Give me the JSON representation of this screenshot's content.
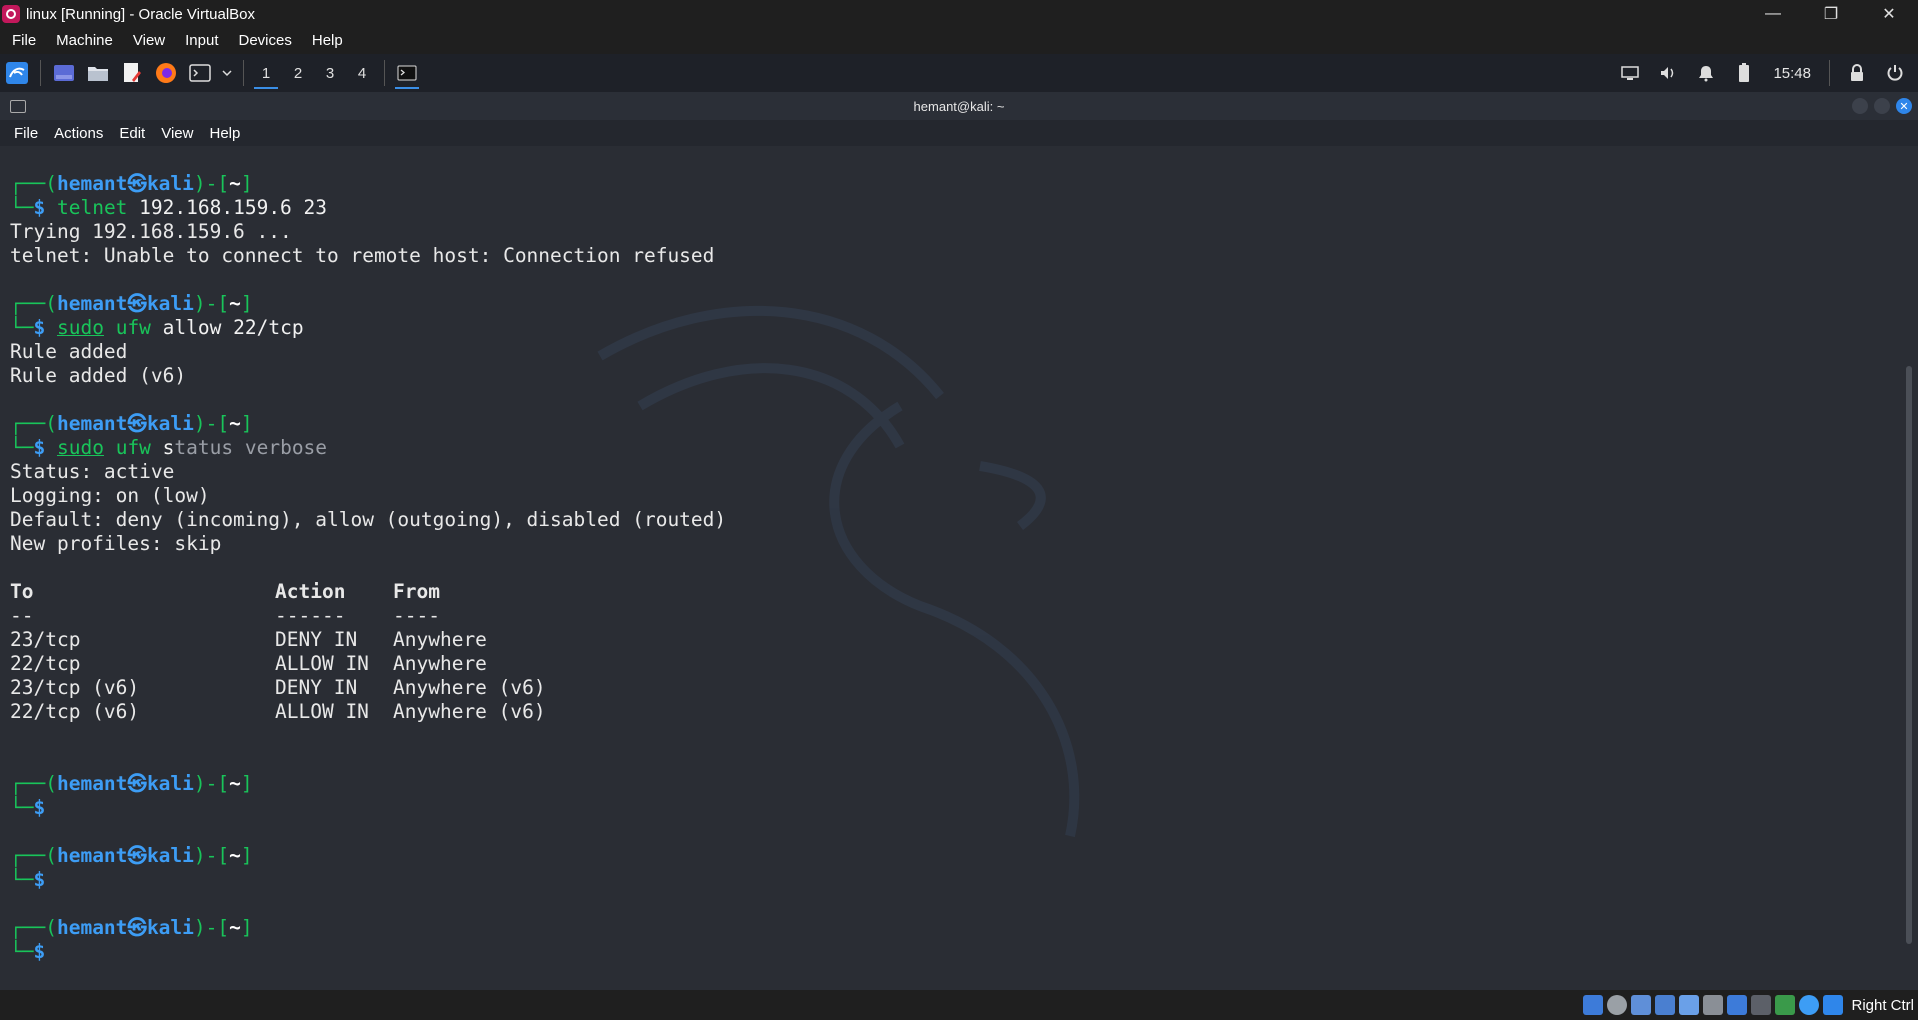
{
  "window": {
    "title": "linux [Running] - Oracle VirtualBox",
    "minimize": "—",
    "restore": "❐",
    "close": "✕"
  },
  "vb_menu": [
    "File",
    "Machine",
    "View",
    "Input",
    "Devices",
    "Help"
  ],
  "panel": {
    "workspaces": [
      "1",
      "2",
      "3",
      "4"
    ],
    "active_workspace": "1",
    "clock": "15:48",
    "icons": [
      "kali-menu-icon",
      "desktop-icon",
      "file-manager-icon",
      "text-editor-icon",
      "firefox-icon",
      "terminal-icon",
      "chevron-down-icon"
    ],
    "tray_icons": [
      "display-icon",
      "volume-icon",
      "notification-icon",
      "battery-icon",
      "lock-icon",
      "power-icon"
    ]
  },
  "terminal": {
    "title": "hemant@kali: ~",
    "menu": [
      "File",
      "Actions",
      "Edit",
      "View",
      "Help"
    ],
    "prompt": {
      "user": "hemant",
      "host": "kali",
      "symbol": "㉿",
      "dir": "~",
      "dollar": "$"
    },
    "commands": {
      "c1": {
        "cmd": "telnet",
        "args": " 192.168.159.6 23"
      },
      "c2": {
        "sudo": "sudo",
        "cmd": "ufw",
        "args": " allow 22/tcp"
      },
      "c3": {
        "sudo": "sudo",
        "cmd": "ufw",
        "typed": " s",
        "ghost": "tatus verbose"
      }
    },
    "output": {
      "telnet_1": "Trying 192.168.159.6 ...",
      "telnet_2": "telnet: Unable to connect to remote host: Connection refused",
      "rule_1": "Rule added",
      "rule_2": "Rule added (v6)",
      "status": "Status: active",
      "logging": "Logging: on (low)",
      "default": "Default: deny (incoming), allow (outgoing), disabled (routed)",
      "profiles": "New profiles: skip"
    },
    "table": {
      "headers": {
        "to": "To",
        "action": "Action",
        "from": "From"
      },
      "dashes": {
        "to": "--",
        "action": "------",
        "from": "----"
      },
      "rows": [
        {
          "to": "23/tcp",
          "action": "DENY IN",
          "from": "Anywhere"
        },
        {
          "to": "22/tcp",
          "action": "ALLOW IN",
          "from": "Anywhere"
        },
        {
          "to": "23/tcp (v6)",
          "action": "DENY IN",
          "from": "Anywhere (v6)"
        },
        {
          "to": "22/tcp (v6)",
          "action": "ALLOW IN",
          "from": "Anywhere (v6)"
        }
      ]
    }
  },
  "status_bar": {
    "host_key": "Right Ctrl",
    "icons": [
      "hard-disk-icon",
      "optical-drive-icon",
      "audio-icon",
      "network-icon",
      "usb-icon",
      "shared-folder-icon",
      "display-icon",
      "recording-icon",
      "cpu-icon",
      "mouse-integration-icon",
      "keyboard-capture-icon"
    ]
  },
  "colors": {
    "prompt_green": "#19c45a",
    "prompt_blue": "#3d9df5",
    "terminal_bg": "#2a2d34",
    "accent": "#2f86ea"
  }
}
